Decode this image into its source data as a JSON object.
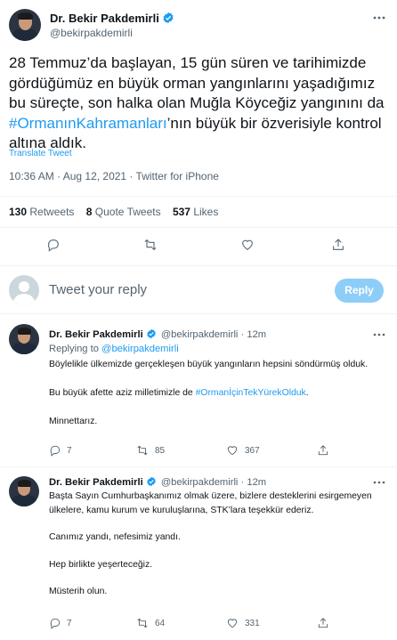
{
  "main_tweet": {
    "author_name": "Dr. Bekir Pakdemirli",
    "author_handle": "@bekirpakdemirli",
    "text_before": "28 Temmuz’da başlayan, 15 gün süren ve tarihimizde gördüğümüz en büyük orman yangınlarını yaşadığımız bu süreçte, son halka olan Muğla Köyceğiz yangınını da ",
    "hashtag": "#OrmanınKahramanları",
    "text_after": "’nın büyük bir özverisiyle kontrol altına aldık.",
    "translate_label": "Translate Tweet",
    "timestamp": "10:36 AM · Aug 12, 2021 · Twitter for iPhone",
    "retweets_count": "130",
    "retweets_label": "Retweets",
    "quotes_count": "8",
    "quotes_label": "Quote Tweets",
    "likes_count": "537",
    "likes_label": "Likes"
  },
  "reply_box": {
    "placeholder": "Tweet your reply",
    "button_label": "Reply"
  },
  "replies": [
    {
      "author_name": "Dr. Bekir Pakdemirli",
      "author_handle": "@bekirpakdemirli",
      "time": "· 12m",
      "replying_to_label": "Replying to",
      "replying_to_handle": "@bekirpakdemirli",
      "para1": "Böylelikle ülkemizde gerçekleşen büyük yangınların hepsini söndürmüş olduk.",
      "para2_before": "Bu büyük afette aziz milletimizle de ",
      "para2_hashtag": "#OrmanİçinTekYürekOlduk",
      "para2_after": ".",
      "para3": "Minnettarız.",
      "replies_count": "7",
      "retweets_count": "85",
      "likes_count": "367"
    },
    {
      "author_name": "Dr. Bekir Pakdemirli",
      "author_handle": "@bekirpakdemirli",
      "time": "· 12m",
      "para1": "Başta Sayın Cumhurbaşkanımız olmak üzere, bizlere desteklerini esirgemeyen ülkelere, kamu kurum ve kuruluşlarına, STK’lara teşekkür ederiz.",
      "para2": "Canımız yandı, nefesimiz yandı.",
      "para3": "Hep birlikte yeşerteceğiz.",
      "para4": "Müsterih olun.",
      "replies_count": "7",
      "retweets_count": "64",
      "likes_count": "331"
    }
  ],
  "colors": {
    "accent": "#1d9bf0",
    "secondary_text": "#536471",
    "reply_button_bg": "#8ecdf8"
  }
}
